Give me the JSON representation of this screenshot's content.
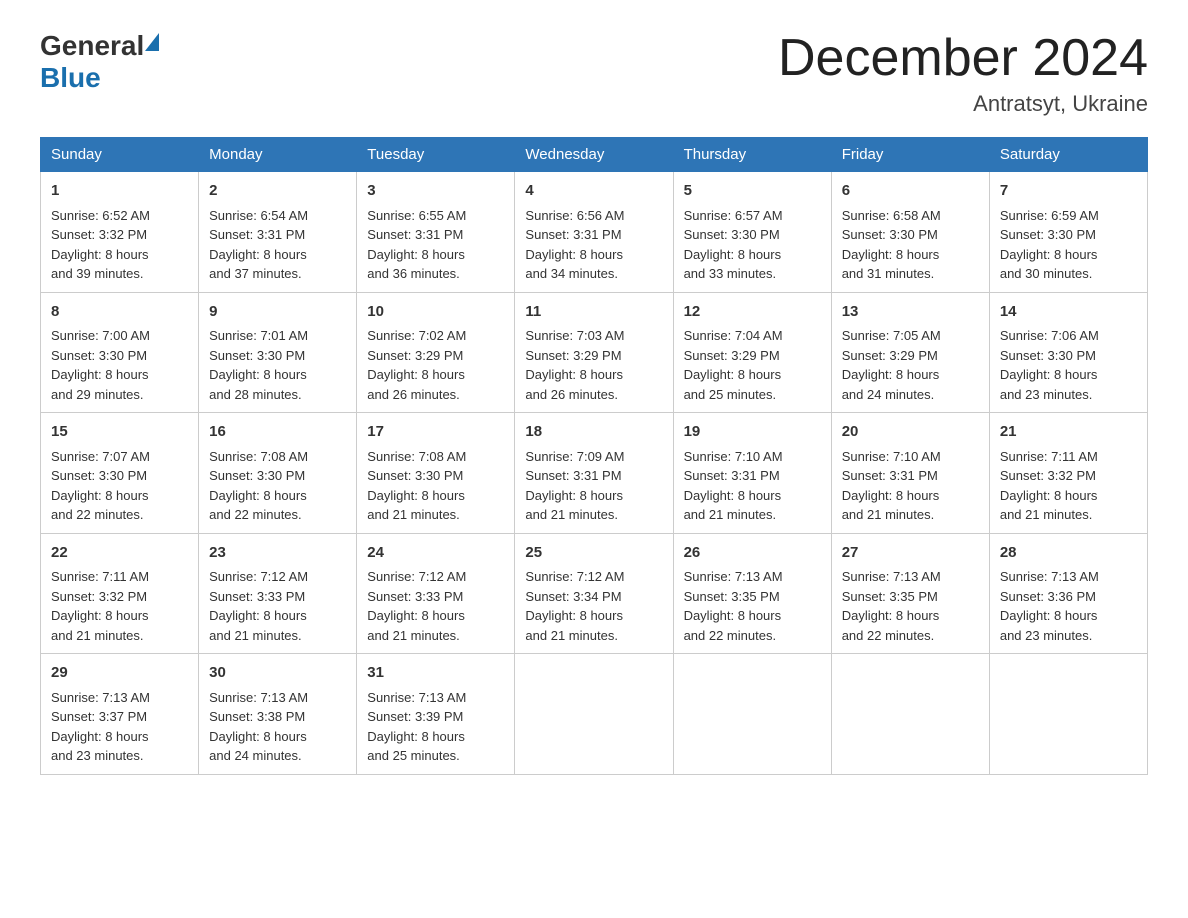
{
  "header": {
    "logo_general": "General",
    "logo_blue": "Blue",
    "month_title": "December 2024",
    "location": "Antratsyt, Ukraine"
  },
  "days_of_week": [
    "Sunday",
    "Monday",
    "Tuesday",
    "Wednesday",
    "Thursday",
    "Friday",
    "Saturday"
  ],
  "weeks": [
    [
      {
        "day": "1",
        "sunrise": "6:52 AM",
        "sunset": "3:32 PM",
        "daylight": "8 hours and 39 minutes."
      },
      {
        "day": "2",
        "sunrise": "6:54 AM",
        "sunset": "3:31 PM",
        "daylight": "8 hours and 37 minutes."
      },
      {
        "day": "3",
        "sunrise": "6:55 AM",
        "sunset": "3:31 PM",
        "daylight": "8 hours and 36 minutes."
      },
      {
        "day": "4",
        "sunrise": "6:56 AM",
        "sunset": "3:31 PM",
        "daylight": "8 hours and 34 minutes."
      },
      {
        "day": "5",
        "sunrise": "6:57 AM",
        "sunset": "3:30 PM",
        "daylight": "8 hours and 33 minutes."
      },
      {
        "day": "6",
        "sunrise": "6:58 AM",
        "sunset": "3:30 PM",
        "daylight": "8 hours and 31 minutes."
      },
      {
        "day": "7",
        "sunrise": "6:59 AM",
        "sunset": "3:30 PM",
        "daylight": "8 hours and 30 minutes."
      }
    ],
    [
      {
        "day": "8",
        "sunrise": "7:00 AM",
        "sunset": "3:30 PM",
        "daylight": "8 hours and 29 minutes."
      },
      {
        "day": "9",
        "sunrise": "7:01 AM",
        "sunset": "3:30 PM",
        "daylight": "8 hours and 28 minutes."
      },
      {
        "day": "10",
        "sunrise": "7:02 AM",
        "sunset": "3:29 PM",
        "daylight": "8 hours and 26 minutes."
      },
      {
        "day": "11",
        "sunrise": "7:03 AM",
        "sunset": "3:29 PM",
        "daylight": "8 hours and 26 minutes."
      },
      {
        "day": "12",
        "sunrise": "7:04 AM",
        "sunset": "3:29 PM",
        "daylight": "8 hours and 25 minutes."
      },
      {
        "day": "13",
        "sunrise": "7:05 AM",
        "sunset": "3:29 PM",
        "daylight": "8 hours and 24 minutes."
      },
      {
        "day": "14",
        "sunrise": "7:06 AM",
        "sunset": "3:30 PM",
        "daylight": "8 hours and 23 minutes."
      }
    ],
    [
      {
        "day": "15",
        "sunrise": "7:07 AM",
        "sunset": "3:30 PM",
        "daylight": "8 hours and 22 minutes."
      },
      {
        "day": "16",
        "sunrise": "7:08 AM",
        "sunset": "3:30 PM",
        "daylight": "8 hours and 22 minutes."
      },
      {
        "day": "17",
        "sunrise": "7:08 AM",
        "sunset": "3:30 PM",
        "daylight": "8 hours and 21 minutes."
      },
      {
        "day": "18",
        "sunrise": "7:09 AM",
        "sunset": "3:31 PM",
        "daylight": "8 hours and 21 minutes."
      },
      {
        "day": "19",
        "sunrise": "7:10 AM",
        "sunset": "3:31 PM",
        "daylight": "8 hours and 21 minutes."
      },
      {
        "day": "20",
        "sunrise": "7:10 AM",
        "sunset": "3:31 PM",
        "daylight": "8 hours and 21 minutes."
      },
      {
        "day": "21",
        "sunrise": "7:11 AM",
        "sunset": "3:32 PM",
        "daylight": "8 hours and 21 minutes."
      }
    ],
    [
      {
        "day": "22",
        "sunrise": "7:11 AM",
        "sunset": "3:32 PM",
        "daylight": "8 hours and 21 minutes."
      },
      {
        "day": "23",
        "sunrise": "7:12 AM",
        "sunset": "3:33 PM",
        "daylight": "8 hours and 21 minutes."
      },
      {
        "day": "24",
        "sunrise": "7:12 AM",
        "sunset": "3:33 PM",
        "daylight": "8 hours and 21 minutes."
      },
      {
        "day": "25",
        "sunrise": "7:12 AM",
        "sunset": "3:34 PM",
        "daylight": "8 hours and 21 minutes."
      },
      {
        "day": "26",
        "sunrise": "7:13 AM",
        "sunset": "3:35 PM",
        "daylight": "8 hours and 22 minutes."
      },
      {
        "day": "27",
        "sunrise": "7:13 AM",
        "sunset": "3:35 PM",
        "daylight": "8 hours and 22 minutes."
      },
      {
        "day": "28",
        "sunrise": "7:13 AM",
        "sunset": "3:36 PM",
        "daylight": "8 hours and 23 minutes."
      }
    ],
    [
      {
        "day": "29",
        "sunrise": "7:13 AM",
        "sunset": "3:37 PM",
        "daylight": "8 hours and 23 minutes."
      },
      {
        "day": "30",
        "sunrise": "7:13 AM",
        "sunset": "3:38 PM",
        "daylight": "8 hours and 24 minutes."
      },
      {
        "day": "31",
        "sunrise": "7:13 AM",
        "sunset": "3:39 PM",
        "daylight": "8 hours and 25 minutes."
      },
      null,
      null,
      null,
      null
    ]
  ],
  "labels": {
    "sunrise": "Sunrise:",
    "sunset": "Sunset:",
    "daylight": "Daylight:"
  }
}
